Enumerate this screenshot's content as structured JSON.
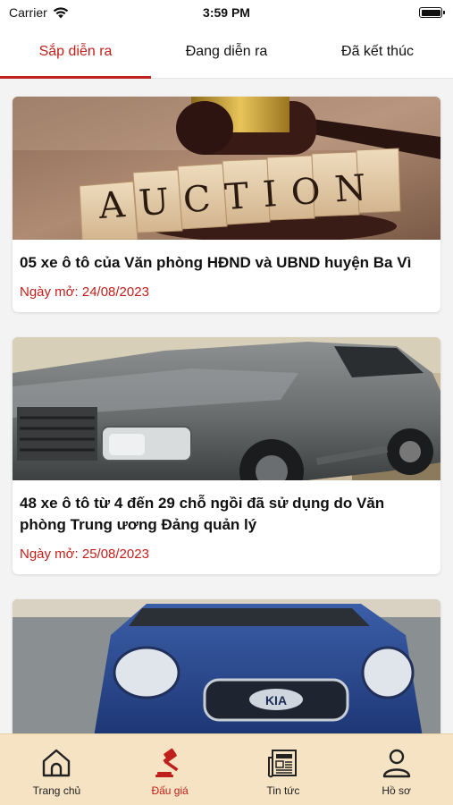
{
  "status_bar": {
    "carrier": "Carrier",
    "time": "3:59 PM"
  },
  "tabs": [
    {
      "label": "Sắp diễn ra",
      "active": true
    },
    {
      "label": "Đang diễn ra",
      "active": false
    },
    {
      "label": "Đã kết thúc",
      "active": false
    }
  ],
  "cards": [
    {
      "title": "05 xe ô tô của Văn phòng HĐND và UBND huyện Ba Vì",
      "date": "Ngày mở: 24/08/2023",
      "image": "auction-gavel-blocks",
      "image_text": "AUCTION"
    },
    {
      "title": "48 xe ô tô từ 4 đến 29 chỗ ngồi đã sử dụng do Văn phòng Trung ương Đảng quản lý",
      "date": "Ngày mở: 25/08/2023",
      "image": "grey-suv-photo"
    },
    {
      "image": "blue-kia-car-photo",
      "image_text": "KIA"
    }
  ],
  "bottom_nav": [
    {
      "label": "Trang chủ",
      "icon": "home-icon",
      "active": false
    },
    {
      "label": "Đấu giá",
      "icon": "gavel-icon",
      "active": true
    },
    {
      "label": "Tin tức",
      "icon": "newspaper-icon",
      "active": false
    },
    {
      "label": "Hồ sơ",
      "icon": "profile-icon",
      "active": false
    }
  ],
  "colors": {
    "accent": "#c0201b",
    "nav_background": "#f6e3c3"
  }
}
